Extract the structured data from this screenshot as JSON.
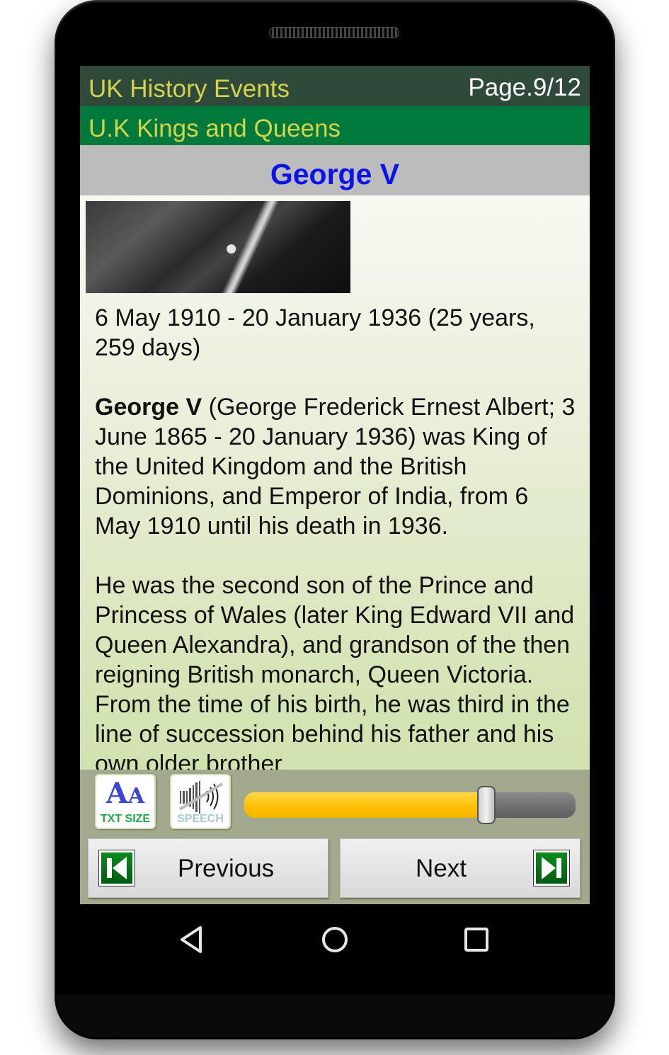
{
  "app": {
    "title": "UK History Events",
    "page_indicator": "Page.9/12",
    "category": "U.K Kings and Queens"
  },
  "article": {
    "heading": "George V",
    "image_alt": "George V portrait (cropped)",
    "reign": "6 May 1910 - 20 January 1936 (25 years, 259 days)",
    "intro_bold": "George V",
    "intro_rest": " (George Frederick Ernest Albert; 3 June 1865 - 20 January 1936) was King of the United Kingdom and the British Dominions, and Emperor of India, from 6 May 1910 until his death in 1936.",
    "paragraph2": "He was the second son of the Prince and Princess of Wales (later King Edward VII and Queen Alexandra), and grandson of the then reigning British monarch, Queen Victoria. From the time of his birth, he was third in the line of succession behind his father and his own older brother"
  },
  "controls": {
    "txt_size_glyph_big": "A",
    "txt_size_glyph_small": "A",
    "txt_size_label": "TXT SIZE",
    "speech_label": "SPEECH",
    "slider_value_percent": 73,
    "previous_label": "Previous",
    "next_label": "Next"
  },
  "colors": {
    "title_bar": "#2f4a3a",
    "category_bar": "#007a3c",
    "title_text": "#d4d44c",
    "heading_text": "#0a14e8",
    "slider_fill": "#ffbf00"
  },
  "system_nav": {
    "back": "back-icon",
    "home": "home-icon",
    "recents": "recents-icon"
  }
}
